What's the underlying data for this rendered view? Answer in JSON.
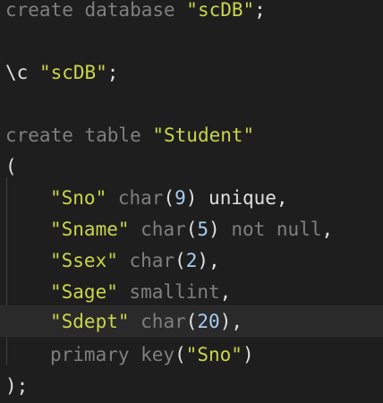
{
  "colors": {
    "background": "#1e1e1e",
    "keyword": "#7f7f7f",
    "string": "#c8d64a",
    "number": "#a8cdef",
    "text": "#e0e0e0",
    "current_line": "#2a2a2a"
  },
  "editor": {
    "lines": [
      {
        "tokens": [
          [
            "kw",
            "create database "
          ],
          [
            "str",
            "\"scDB\""
          ],
          [
            "punct",
            ";"
          ]
        ]
      },
      {
        "tokens": []
      },
      {
        "tokens": [
          [
            "plain",
            "\\c "
          ],
          [
            "str",
            "\"scDB\""
          ],
          [
            "punct",
            ";"
          ]
        ]
      },
      {
        "tokens": []
      },
      {
        "tokens": [
          [
            "kw",
            "create table "
          ],
          [
            "str",
            "\"Student\""
          ]
        ]
      },
      {
        "tokens": [
          [
            "punct",
            "("
          ]
        ]
      },
      {
        "tokens": [
          [
            "indent",
            ""
          ],
          [
            "str",
            "\"Sno\""
          ],
          [
            "kw",
            " char"
          ],
          [
            "punct",
            "("
          ],
          [
            "num",
            "9"
          ],
          [
            "punct",
            ")"
          ],
          [
            "plain",
            " unique,"
          ]
        ]
      },
      {
        "tokens": [
          [
            "indent",
            ""
          ],
          [
            "str",
            "\"Sname\""
          ],
          [
            "kw",
            " char"
          ],
          [
            "punct",
            "("
          ],
          [
            "num",
            "5"
          ],
          [
            "punct",
            ")"
          ],
          [
            "kw",
            " not null"
          ],
          [
            "punct",
            ","
          ]
        ]
      },
      {
        "tokens": [
          [
            "indent",
            ""
          ],
          [
            "str",
            "\"Ssex\""
          ],
          [
            "kw",
            " char"
          ],
          [
            "punct",
            "("
          ],
          [
            "num",
            "2"
          ],
          [
            "punct",
            "),"
          ]
        ]
      },
      {
        "tokens": [
          [
            "indent",
            ""
          ],
          [
            "str",
            "\"Sage\""
          ],
          [
            "kw",
            " smallint"
          ],
          [
            "punct",
            ","
          ]
        ]
      },
      {
        "tokens": [
          [
            "indent",
            ""
          ],
          [
            "str",
            "\"Sdept\""
          ],
          [
            "kw",
            " char"
          ],
          [
            "punct",
            "("
          ],
          [
            "num",
            "20"
          ],
          [
            "punct",
            "),"
          ]
        ],
        "current": true
      },
      {
        "tokens": [
          [
            "indent",
            ""
          ],
          [
            "kw",
            "primary key"
          ],
          [
            "punct",
            "("
          ],
          [
            "str",
            "\"Sno\""
          ],
          [
            "punct",
            ")"
          ]
        ]
      },
      {
        "tokens": [
          [
            "punct",
            ");"
          ]
        ]
      }
    ]
  }
}
